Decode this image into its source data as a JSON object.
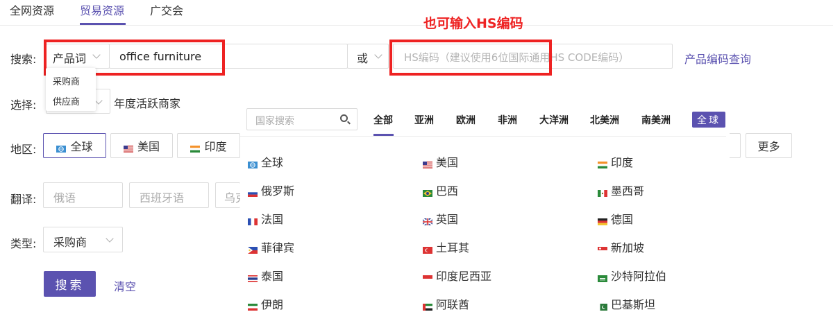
{
  "nav": {
    "tabs": [
      {
        "label": "全网资源"
      },
      {
        "label": "贸易资源"
      },
      {
        "label": "广交会"
      }
    ]
  },
  "annotation": {
    "text": "也可输入HS编码"
  },
  "search": {
    "label": "搜索:",
    "type_value": "产品词",
    "keyword": "office furniture",
    "or_label": "或",
    "hs_placeholder": "HS编码（建议使用6位国际通用HS CODE编码）",
    "hs_lookup_link": "产品编码查询",
    "type_options": [
      "采购商",
      "供应商"
    ]
  },
  "select": {
    "label": "选择:",
    "checkbox_label": "年度活跃商家"
  },
  "region": {
    "label": "地区:",
    "buttons": [
      {
        "label": "全球",
        "flag": "globe"
      },
      {
        "label": "美国",
        "flag": "us"
      },
      {
        "label": "印度",
        "flag": "in"
      }
    ],
    "more_label": "更多"
  },
  "translate": {
    "label": "翻译:",
    "fields": [
      {
        "placeholder": "俄语"
      },
      {
        "placeholder": "西班牙语"
      },
      {
        "placeholder": "乌克"
      }
    ]
  },
  "type_filter": {
    "label": "类型:",
    "value": "采购商"
  },
  "actions": {
    "search_label": "搜索",
    "clear_label": "清空"
  },
  "country_panel": {
    "search_placeholder": "国家搜索",
    "tabs": [
      "全部",
      "亚洲",
      "欧洲",
      "非洲",
      "大洋洲",
      "北美洲",
      "南美洲"
    ],
    "global_tag": "全球",
    "countries": [
      {
        "name": "全球",
        "flag": "globe"
      },
      {
        "name": "美国",
        "flag": "us"
      },
      {
        "name": "印度",
        "flag": "in"
      },
      {
        "name": "俄罗斯",
        "flag": "ru"
      },
      {
        "name": "巴西",
        "flag": "br"
      },
      {
        "name": "墨西哥",
        "flag": "mx"
      },
      {
        "name": "法国",
        "flag": "fr"
      },
      {
        "name": "英国",
        "flag": "gb"
      },
      {
        "name": "德国",
        "flag": "de"
      },
      {
        "name": "菲律宾",
        "flag": "ph"
      },
      {
        "name": "土耳其",
        "flag": "tr"
      },
      {
        "name": "新加坡",
        "flag": "sg"
      },
      {
        "name": "泰国",
        "flag": "th"
      },
      {
        "name": "印度尼西亚",
        "flag": "id"
      },
      {
        "name": "沙特阿拉伯",
        "flag": "sa"
      },
      {
        "name": "伊朗",
        "flag": "ir"
      },
      {
        "name": "阿联酋",
        "flag": "ae"
      },
      {
        "name": "巴基斯坦",
        "flag": "pk"
      }
    ]
  },
  "colors": {
    "accent": "#5b52b0",
    "annotation": "#ee2222"
  }
}
